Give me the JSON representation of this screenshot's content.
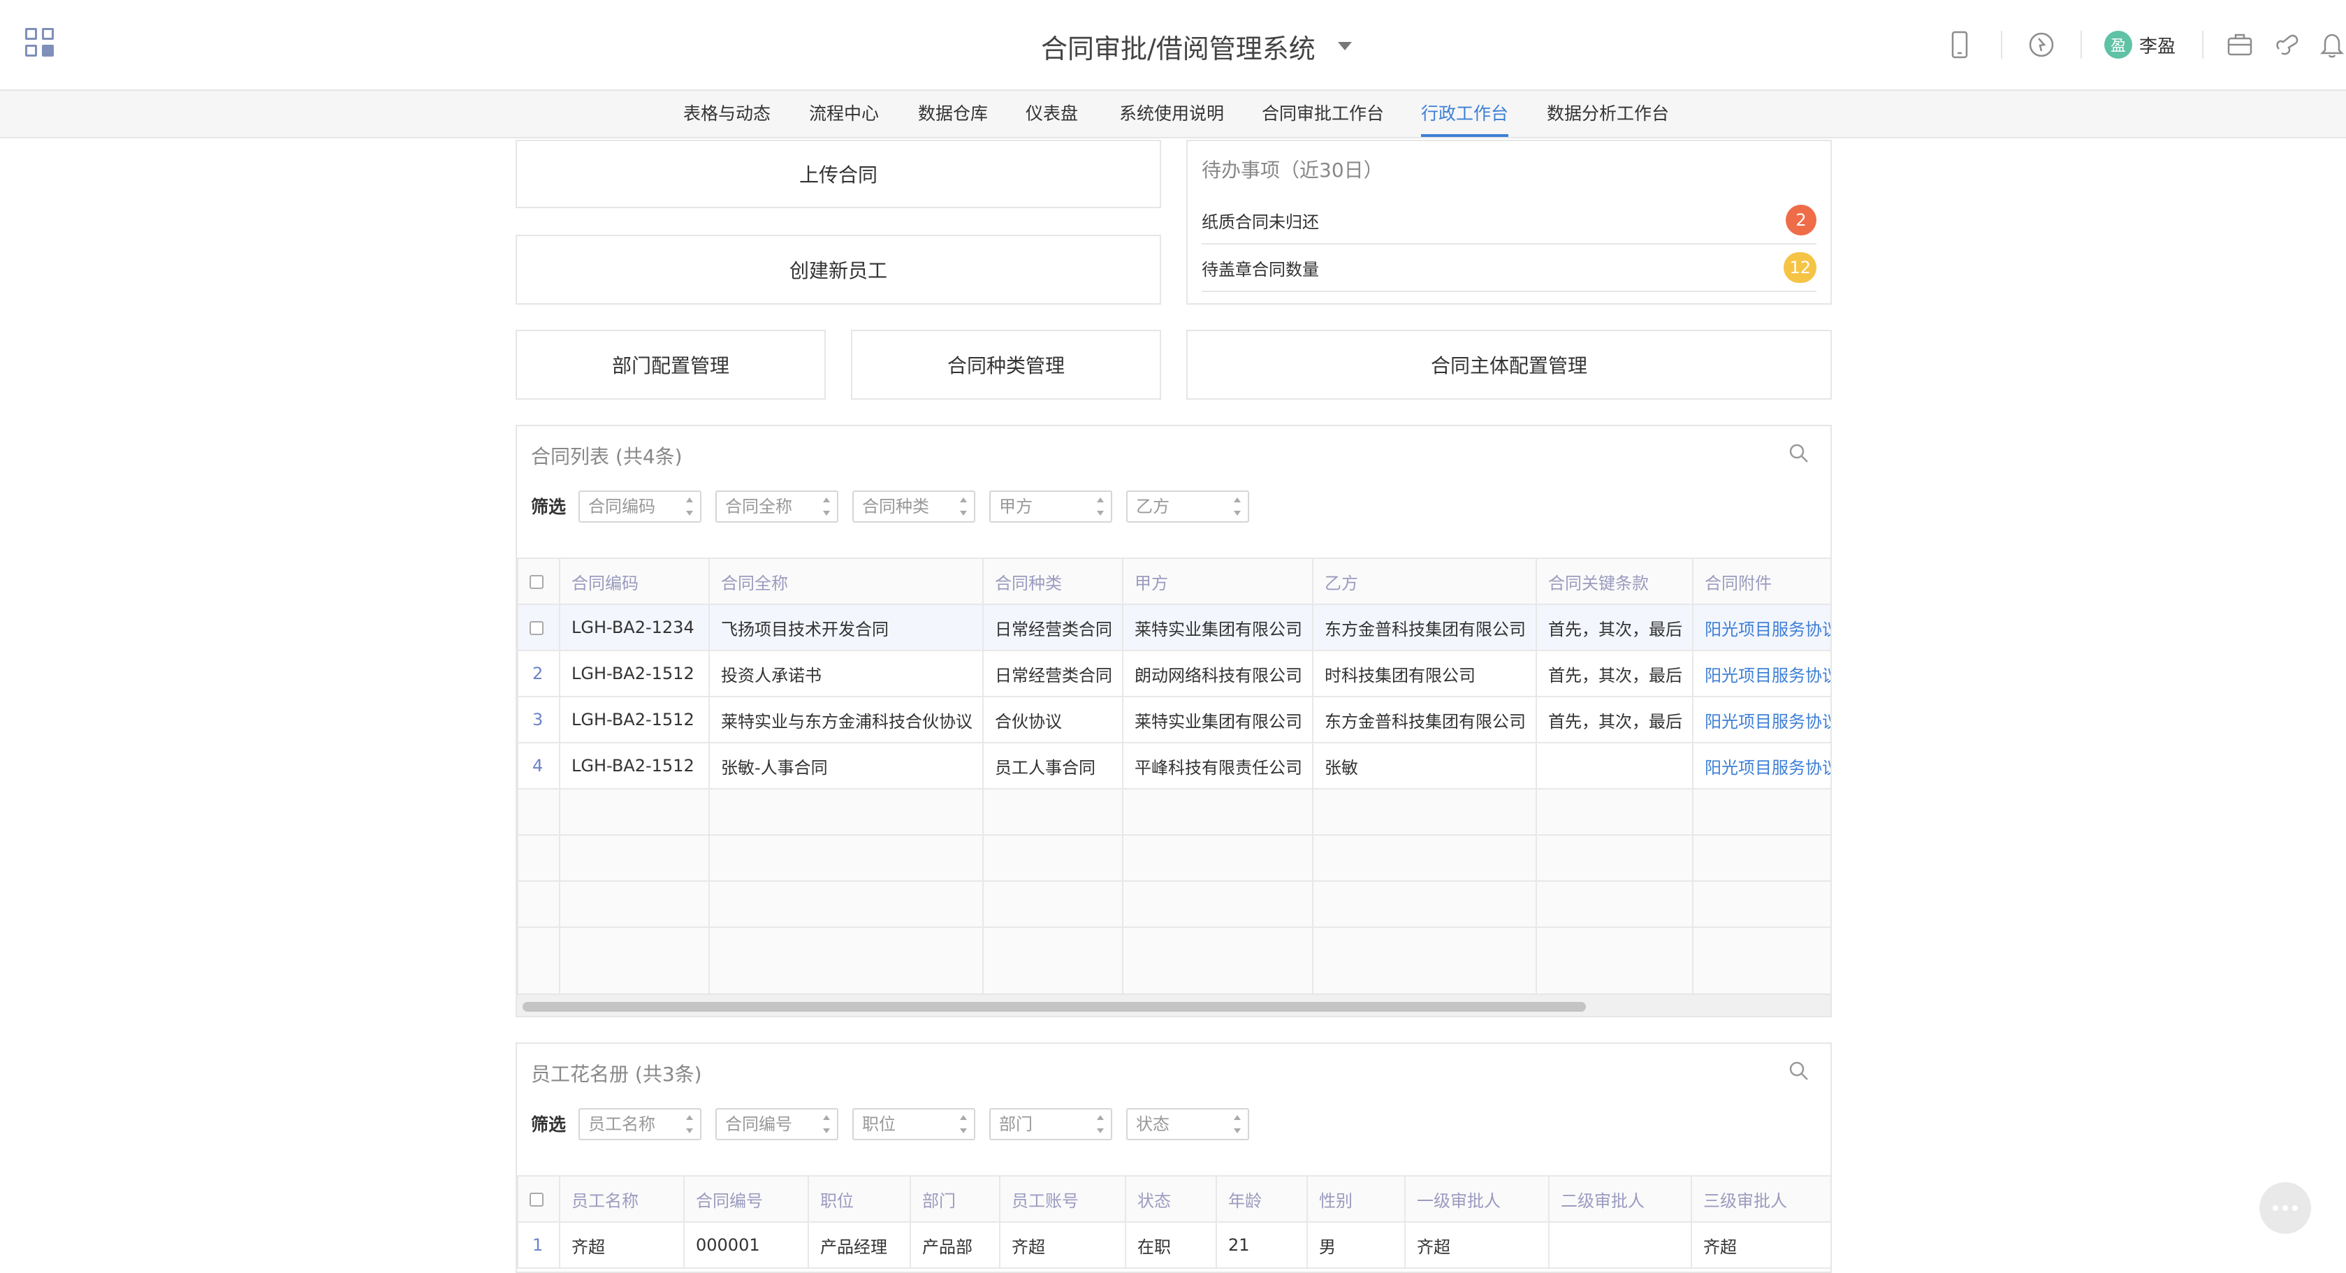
{
  "header": {
    "title": "合同审批/借阅管理系统",
    "user": {
      "avatar_text": "盈",
      "name": "李盈"
    }
  },
  "nav": {
    "tabs": [
      "表格与动态",
      "流程中心",
      "数据仓库",
      "仪表盘",
      "系统使用说明",
      "合同审批工作台",
      "行政工作台",
      "数据分析工作台"
    ],
    "active": "行政工作台"
  },
  "actions": {
    "upload_contract": "上传合同",
    "create_employee": "创建新员工",
    "dept_config": "部门配置管理",
    "contract_type_mgmt": "合同种类管理",
    "contract_entity_config": "合同主体配置管理"
  },
  "todo": {
    "title": "待办事项（近30日）",
    "items": [
      {
        "label": "纸质合同未归还",
        "count": "2",
        "color": "#ef6c49"
      },
      {
        "label": "待盖章合同数量",
        "count": "12",
        "color": "#f5c445"
      }
    ]
  },
  "contract_list": {
    "title": "合同列表 (共4条)",
    "filter_label": "筛选",
    "filters": [
      "合同编码",
      "合同全称",
      "合同种类",
      "甲方",
      "乙方"
    ],
    "columns": [
      "合同编码",
      "合同全称",
      "合同种类",
      "甲方",
      "乙方",
      "合同关键条款",
      "合同附件"
    ],
    "rows": [
      [
        "LGH-BA2-1234",
        "飞扬项目技术开发合同",
        "日常经营类合同",
        "莱特实业集团有限公司",
        "东方金普科技集团有限公司",
        "首先，其次，最后",
        "阳光项目服务协议"
      ],
      [
        "LGH-BA2-1512",
        "投资人承诺书",
        "日常经营类合同",
        "朗动网络科技有限公司",
        "时科技集团有限公司",
        "首先，其次，最后",
        "阳光项目服务协议"
      ],
      [
        "LGH-BA2-1512",
        "莱特实业与东方金浦科技合伙协议",
        "合伙协议",
        "莱特实业集团有限公司",
        "东方金普科技集团有限公司",
        "首先，其次，最后",
        "阳光项目服务协议"
      ],
      [
        "LGH-BA2-1512",
        "张敏-人事合同",
        "员工人事合同",
        "平峰科技有限责任公司",
        "张敏",
        "",
        "阳光项目服务协议"
      ]
    ],
    "row_numbers": [
      "",
      "2",
      "3",
      "4"
    ]
  },
  "employee_list": {
    "title": "员工花名册 (共3条)",
    "filter_label": "筛选",
    "filters": [
      "员工名称",
      "合同编号",
      "职位",
      "部门",
      "状态"
    ],
    "columns": [
      "员工名称",
      "合同编号",
      "职位",
      "部门",
      "员工账号",
      "状态",
      "年龄",
      "性别",
      "一级审批人",
      "二级审批人",
      "三级审批人"
    ],
    "rows": [
      [
        "齐超",
        "000001",
        "产品经理",
        "产品部",
        "齐超",
        "在职",
        "21",
        "男",
        "齐超",
        "",
        "齐超"
      ]
    ],
    "row_numbers": [
      "1"
    ]
  }
}
